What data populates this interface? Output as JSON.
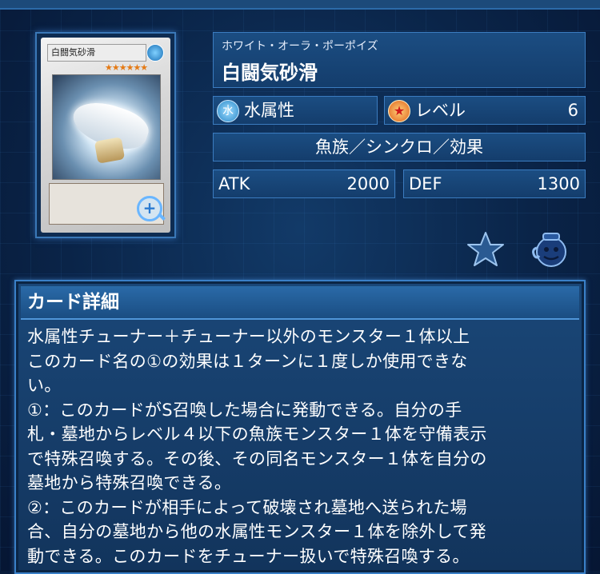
{
  "card": {
    "ruby": "ホワイト・オーラ・ポーポイズ",
    "name": "白闘気砂滑",
    "thumbnail_name": "白闘気砂滑",
    "thumbnail_stars": "★★★★★★"
  },
  "stats": {
    "attribute": "水属性",
    "attribute_icon_glyph": "水",
    "level_label": "レベル",
    "level_value": "6",
    "level_icon_glyph": "★",
    "type_line": "魚族／シンクロ／効果",
    "atk_label": "ATK",
    "atk_value": "2000",
    "def_label": "DEF",
    "def_value": "1300"
  },
  "actions": {
    "zoom_icon": "magnifier-plus-icon",
    "favorite_icon": "star-icon",
    "deck_icon": "pot-icon"
  },
  "detail": {
    "title": "カード詳細",
    "text": "水属性チューナー＋チューナー以外のモンスター１体以上\nこのカード名の①の効果は１ターンに１度しか使用できな\nい。\n①：このカードがS召喚した場合に発動できる。自分の手\n札・墓地からレベル４以下の魚族モンスター１体を守備表示\nで特殊召喚する。その後、その同名モンスター１体を自分の\n墓地から特殊召喚できる。\n②：このカードが相手によって破壊され墓地へ送られた場\n合、自分の墓地から他の水属性モンスター１体を除外して発\n動できる。このカードをチューナー扱いで特殊召喚する。"
  },
  "colors": {
    "background": "#0a2448",
    "panel": "#1b4d82",
    "border": "#3b7cc0",
    "level_accent": "#e0621a",
    "water_accent": "#2a88c8"
  }
}
